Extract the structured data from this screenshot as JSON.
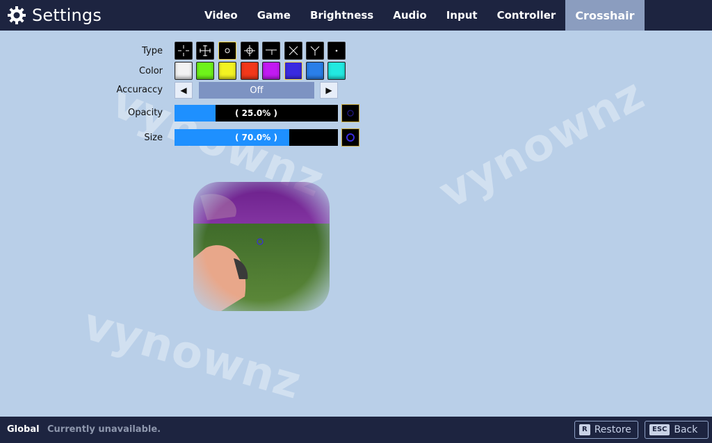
{
  "header": {
    "title": "Settings",
    "tabs": [
      {
        "label": "Video"
      },
      {
        "label": "Game"
      },
      {
        "label": "Brightness"
      },
      {
        "label": "Audio"
      },
      {
        "label": "Input"
      },
      {
        "label": "Controller"
      },
      {
        "label": "Crosshair",
        "active": true
      }
    ]
  },
  "crosshair": {
    "type_label": "Type",
    "type_icons": [
      "crosshair-cross-gap-icon",
      "crosshair-cross-ticks-icon",
      "crosshair-circle-icon",
      "crosshair-circle-cross-icon",
      "crosshair-t-icon",
      "crosshair-x-icon",
      "crosshair-y-icon",
      "crosshair-dot-icon"
    ],
    "type_selected_index": 2,
    "color_label": "Color",
    "colors": [
      "#f2f2f2",
      "#6ef21a",
      "#f2f222",
      "#f2381a",
      "#c21af2",
      "#3a2ae0",
      "#2a7fe8",
      "#22e8e0"
    ],
    "color_selected_index": 5,
    "accuracy_label": "Accuraccy",
    "accuracy_value": "Off",
    "accuracy_prev": "◀",
    "accuracy_next": "▶",
    "opacity_label": "Opacity",
    "opacity_text": "( 25.0% )",
    "opacity_fraction": 0.25,
    "size_label": "Size",
    "size_text": "( 70.0% )",
    "size_fraction": 0.7
  },
  "watermark": "vynownz",
  "footer": {
    "scope": "Global",
    "status": "Currently unavailable.",
    "restore_key": "R",
    "restore_label": "Restore",
    "back_key": "ESC",
    "back_label": "Back"
  },
  "colors": {
    "bar_bg": "#1d2440",
    "page_bg": "#b9cfe8",
    "active_tab": "#8b9dbf",
    "slider_fill": "#1e90ff"
  }
}
